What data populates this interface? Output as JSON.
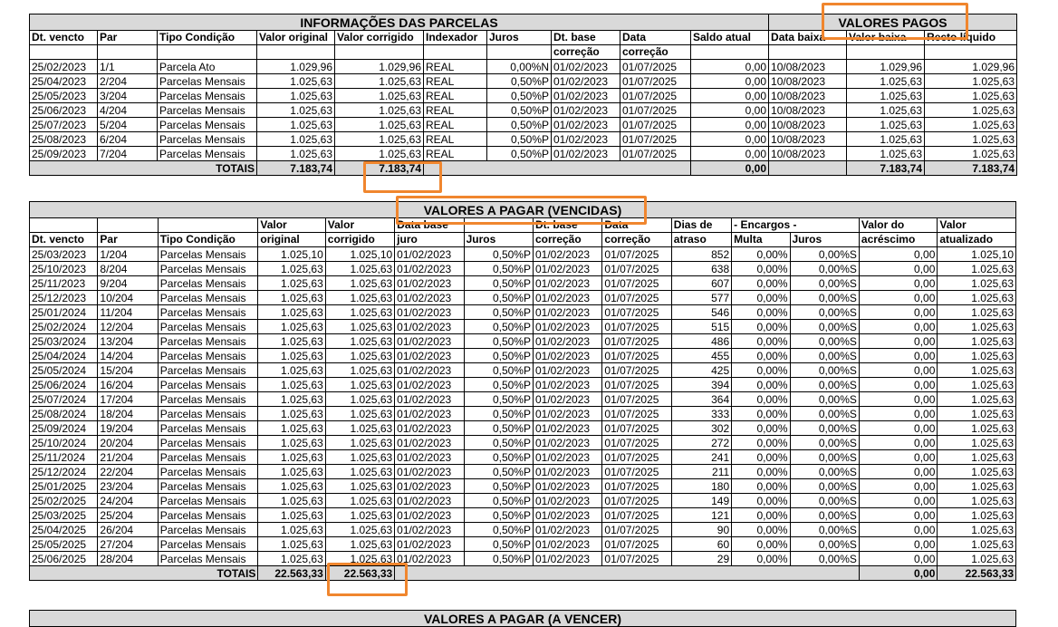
{
  "colors": {
    "highlight": "#f0862e",
    "band": "#d9d9d9"
  },
  "section1": {
    "title": "INFORMAÇÕES DAS PARCELAS",
    "paid_title": "VALORES PAGOS",
    "headers": [
      "Dt. vencto",
      "Par",
      "Tipo Condição",
      "Valor original",
      "Valor corrigido",
      "Indexador",
      "Juros",
      "Dt. base",
      "Data",
      "Saldo atual",
      "Data baixa",
      "Valor baixa",
      "Recto líquido"
    ],
    "headers2": [
      "",
      "",
      "",
      "",
      "",
      "",
      "",
      "correção",
      "correção",
      "",
      "",
      "",
      ""
    ],
    "rows": [
      [
        "25/02/2023",
        "1/1",
        "Parcela Ato",
        "1.029,96",
        "1.029,96",
        "REAL",
        "0,00%N",
        "01/02/2023",
        "01/07/2025",
        "0,00",
        "10/08/2023",
        "1.029,96",
        "1.029,96"
      ],
      [
        "25/04/2023",
        "2/204",
        "Parcelas Mensais",
        "1.025,63",
        "1.025,63",
        "REAL",
        "0,50%P",
        "01/02/2023",
        "01/07/2025",
        "0,00",
        "10/08/2023",
        "1.025,63",
        "1.025,63"
      ],
      [
        "25/05/2023",
        "3/204",
        "Parcelas Mensais",
        "1.025,63",
        "1.025,63",
        "REAL",
        "0,50%P",
        "01/02/2023",
        "01/07/2025",
        "0,00",
        "10/08/2023",
        "1.025,63",
        "1.025,63"
      ],
      [
        "25/06/2023",
        "4/204",
        "Parcelas Mensais",
        "1.025,63",
        "1.025,63",
        "REAL",
        "0,50%P",
        "01/02/2023",
        "01/07/2025",
        "0,00",
        "10/08/2023",
        "1.025,63",
        "1.025,63"
      ],
      [
        "25/07/2023",
        "5/204",
        "Parcelas Mensais",
        "1.025,63",
        "1.025,63",
        "REAL",
        "0,50%P",
        "01/02/2023",
        "01/07/2025",
        "0,00",
        "10/08/2023",
        "1.025,63",
        "1.025,63"
      ],
      [
        "25/08/2023",
        "6/204",
        "Parcelas Mensais",
        "1.025,63",
        "1.025,63",
        "REAL",
        "0,50%P",
        "01/02/2023",
        "01/07/2025",
        "0,00",
        "10/08/2023",
        "1.025,63",
        "1.025,63"
      ],
      [
        "25/09/2023",
        "7/204",
        "Parcelas Mensais",
        "1.025,63",
        "1.025,63",
        "REAL",
        "0,50%P",
        "01/02/2023",
        "01/07/2025",
        "0,00",
        "10/08/2023",
        "1.025,63",
        "1.025,63"
      ]
    ],
    "totals": {
      "label": "TOTAIS",
      "original": "7.183,74",
      "corrigido": "7.183,74",
      "saldo": "0,00",
      "baixa": "7.183,74",
      "recto": "7.183,74"
    }
  },
  "section2": {
    "title": "VALORES A PAGAR (VENCIDAS)",
    "headers_top": [
      "",
      "",
      "",
      "Valor",
      "Valor",
      "Data base",
      "",
      "Dt. base",
      "Data",
      "Dias de",
      "- Encargos -",
      "Valor do",
      "Valor"
    ],
    "headers_bottom": [
      "Dt. vencto",
      "Par",
      "Tipo Condição",
      "original",
      "corrigido",
      "juro",
      "Juros",
      "correção",
      "correção",
      "atraso",
      "Multa",
      "Juros",
      "acréscimo",
      "atualizado"
    ],
    "rows": [
      [
        "25/03/2023",
        "1/204",
        "Parcelas Mensais",
        "1.025,10",
        "1.025,10",
        "01/02/2023",
        "0,50%P",
        "01/02/2023",
        "01/07/2025",
        "852",
        "0,00%",
        "0,00%S",
        "0,00",
        "1.025,10"
      ],
      [
        "25/10/2023",
        "8/204",
        "Parcelas Mensais",
        "1.025,63",
        "1.025,63",
        "01/02/2023",
        "0,50%P",
        "01/02/2023",
        "01/07/2025",
        "638",
        "0,00%",
        "0,00%S",
        "0,00",
        "1.025,63"
      ],
      [
        "25/11/2023",
        "9/204",
        "Parcelas Mensais",
        "1.025,63",
        "1.025,63",
        "01/02/2023",
        "0,50%P",
        "01/02/2023",
        "01/07/2025",
        "607",
        "0,00%",
        "0,00%S",
        "0,00",
        "1.025,63"
      ],
      [
        "25/12/2023",
        "10/204",
        "Parcelas Mensais",
        "1.025,63",
        "1.025,63",
        "01/02/2023",
        "0,50%P",
        "01/02/2023",
        "01/07/2025",
        "577",
        "0,00%",
        "0,00%S",
        "0,00",
        "1.025,63"
      ],
      [
        "25/01/2024",
        "11/204",
        "Parcelas Mensais",
        "1.025,63",
        "1.025,63",
        "01/02/2023",
        "0,50%P",
        "01/02/2023",
        "01/07/2025",
        "546",
        "0,00%",
        "0,00%S",
        "0,00",
        "1.025,63"
      ],
      [
        "25/02/2024",
        "12/204",
        "Parcelas Mensais",
        "1.025,63",
        "1.025,63",
        "01/02/2023",
        "0,50%P",
        "01/02/2023",
        "01/07/2025",
        "515",
        "0,00%",
        "0,00%S",
        "0,00",
        "1.025,63"
      ],
      [
        "25/03/2024",
        "13/204",
        "Parcelas Mensais",
        "1.025,63",
        "1.025,63",
        "01/02/2023",
        "0,50%P",
        "01/02/2023",
        "01/07/2025",
        "486",
        "0,00%",
        "0,00%S",
        "0,00",
        "1.025,63"
      ],
      [
        "25/04/2024",
        "14/204",
        "Parcelas Mensais",
        "1.025,63",
        "1.025,63",
        "01/02/2023",
        "0,50%P",
        "01/02/2023",
        "01/07/2025",
        "455",
        "0,00%",
        "0,00%S",
        "0,00",
        "1.025,63"
      ],
      [
        "25/05/2024",
        "15/204",
        "Parcelas Mensais",
        "1.025,63",
        "1.025,63",
        "01/02/2023",
        "0,50%P",
        "01/02/2023",
        "01/07/2025",
        "425",
        "0,00%",
        "0,00%S",
        "0,00",
        "1.025,63"
      ],
      [
        "25/06/2024",
        "16/204",
        "Parcelas Mensais",
        "1.025,63",
        "1.025,63",
        "01/02/2023",
        "0,50%P",
        "01/02/2023",
        "01/07/2025",
        "394",
        "0,00%",
        "0,00%S",
        "0,00",
        "1.025,63"
      ],
      [
        "25/07/2024",
        "17/204",
        "Parcelas Mensais",
        "1.025,63",
        "1.025,63",
        "01/02/2023",
        "0,50%P",
        "01/02/2023",
        "01/07/2025",
        "364",
        "0,00%",
        "0,00%S",
        "0,00",
        "1.025,63"
      ],
      [
        "25/08/2024",
        "18/204",
        "Parcelas Mensais",
        "1.025,63",
        "1.025,63",
        "01/02/2023",
        "0,50%P",
        "01/02/2023",
        "01/07/2025",
        "333",
        "0,00%",
        "0,00%S",
        "0,00",
        "1.025,63"
      ],
      [
        "25/09/2024",
        "19/204",
        "Parcelas Mensais",
        "1.025,63",
        "1.025,63",
        "01/02/2023",
        "0,50%P",
        "01/02/2023",
        "01/07/2025",
        "302",
        "0,00%",
        "0,00%S",
        "0,00",
        "1.025,63"
      ],
      [
        "25/10/2024",
        "20/204",
        "Parcelas Mensais",
        "1.025,63",
        "1.025,63",
        "01/02/2023",
        "0,50%P",
        "01/02/2023",
        "01/07/2025",
        "272",
        "0,00%",
        "0,00%S",
        "0,00",
        "1.025,63"
      ],
      [
        "25/11/2024",
        "21/204",
        "Parcelas Mensais",
        "1.025,63",
        "1.025,63",
        "01/02/2023",
        "0,50%P",
        "01/02/2023",
        "01/07/2025",
        "241",
        "0,00%",
        "0,00%S",
        "0,00",
        "1.025,63"
      ],
      [
        "25/12/2024",
        "22/204",
        "Parcelas Mensais",
        "1.025,63",
        "1.025,63",
        "01/02/2023",
        "0,50%P",
        "01/02/2023",
        "01/07/2025",
        "211",
        "0,00%",
        "0,00%S",
        "0,00",
        "1.025,63"
      ],
      [
        "25/01/2025",
        "23/204",
        "Parcelas Mensais",
        "1.025,63",
        "1.025,63",
        "01/02/2023",
        "0,50%P",
        "01/02/2023",
        "01/07/2025",
        "180",
        "0,00%",
        "0,00%S",
        "0,00",
        "1.025,63"
      ],
      [
        "25/02/2025",
        "24/204",
        "Parcelas Mensais",
        "1.025,63",
        "1.025,63",
        "01/02/2023",
        "0,50%P",
        "01/02/2023",
        "01/07/2025",
        "149",
        "0,00%",
        "0,00%S",
        "0,00",
        "1.025,63"
      ],
      [
        "25/03/2025",
        "25/204",
        "Parcelas Mensais",
        "1.025,63",
        "1.025,63",
        "01/02/2023",
        "0,50%P",
        "01/02/2023",
        "01/07/2025",
        "121",
        "0,00%",
        "0,00%S",
        "0,00",
        "1.025,63"
      ],
      [
        "25/04/2025",
        "26/204",
        "Parcelas Mensais",
        "1.025,63",
        "1.025,63",
        "01/02/2023",
        "0,50%P",
        "01/02/2023",
        "01/07/2025",
        "90",
        "0,00%",
        "0,00%S",
        "0,00",
        "1.025,63"
      ],
      [
        "25/05/2025",
        "27/204",
        "Parcelas Mensais",
        "1.025,63",
        "1.025,63",
        "01/02/2023",
        "0,50%P",
        "01/02/2023",
        "01/07/2025",
        "60",
        "0,00%",
        "0,00%S",
        "0,00",
        "1.025,63"
      ],
      [
        "25/06/2025",
        "28/204",
        "Parcelas Mensais",
        "1.025,63",
        "1.025,63",
        "01/02/2023",
        "0,50%P",
        "01/02/2023",
        "01/07/2025",
        "29",
        "0,00%",
        "0,00%S",
        "0,00",
        "1.025,63"
      ]
    ],
    "totals": {
      "label": "TOTAIS",
      "original": "22.563,33",
      "corrigido": "22.563,33",
      "acrescimo": "0,00",
      "atualizado": "22.563,33"
    }
  },
  "section3": {
    "title": "VALORES A PAGAR (A VENCER)"
  }
}
